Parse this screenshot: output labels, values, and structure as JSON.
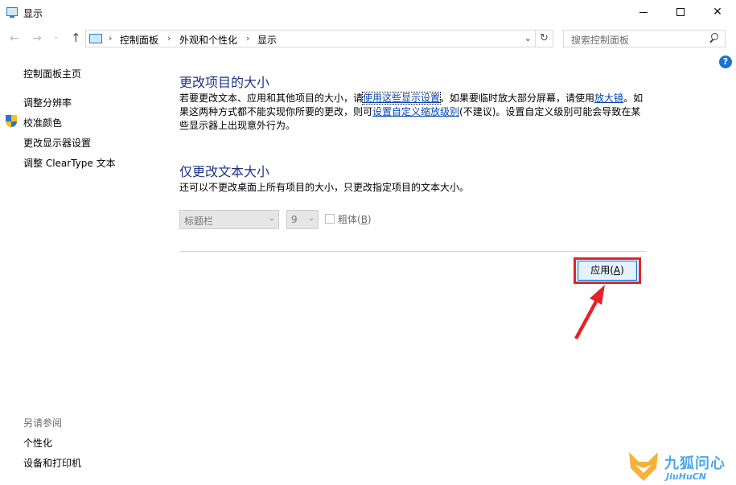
{
  "window": {
    "title": "显示",
    "minimize_glyph": "",
    "close_glyph": "✕"
  },
  "navbar": {
    "back_glyph": "←",
    "forward_glyph": "→",
    "dropdown_glyph": "⌄",
    "up_glyph": "↑",
    "breadcrumbs": [
      "控制面板",
      "外观和个性化",
      "显示"
    ],
    "separator": "›",
    "address_dropdown_glyph": "⌄",
    "refresh_glyph": "↻",
    "search_placeholder": "搜索控制面板"
  },
  "help": {
    "glyph": "?"
  },
  "sidebar": {
    "home": "控制面板主页",
    "items": [
      "调整分辨率",
      "校准颜色",
      "更改显示器设置",
      "调整 ClearType 文本"
    ],
    "see_also_heading": "另请参阅",
    "see_also": [
      "个性化",
      "设备和打印机"
    ]
  },
  "main": {
    "section1": {
      "heading": "更改项目的大小",
      "text_a": "若要更改文本、应用和其他项目的大小，请",
      "link_a": "使用这些显示设置",
      "text_b": "。如果要临时放大部分屏幕，请使用",
      "link_b": "放大镜",
      "text_c": "。如果这两种方式都不能实现你所要的更改，则可",
      "link_c": "设置自定义缩放级别",
      "text_d": "(不建议)。设置自定义级别可能会导致在某些显示器上出现意外行为。"
    },
    "section2": {
      "heading": "仅更改文本大小",
      "description": "还可以不更改桌面上所有项目的大小，只更改指定项目的文本大小。",
      "item_select": "标题栏",
      "size_select": "9",
      "select_chevron": "⌄",
      "bold_label": "粗体(",
      "bold_key": "B",
      "bold_suffix": ")",
      "bold_checked": false
    },
    "apply": {
      "label": "应用(",
      "key": "A",
      "suffix": ")"
    }
  },
  "annotation": {
    "highlight_color": "#e2242a"
  },
  "watermark": {
    "cn": "九狐问心",
    "en": "JiuHuCN"
  }
}
